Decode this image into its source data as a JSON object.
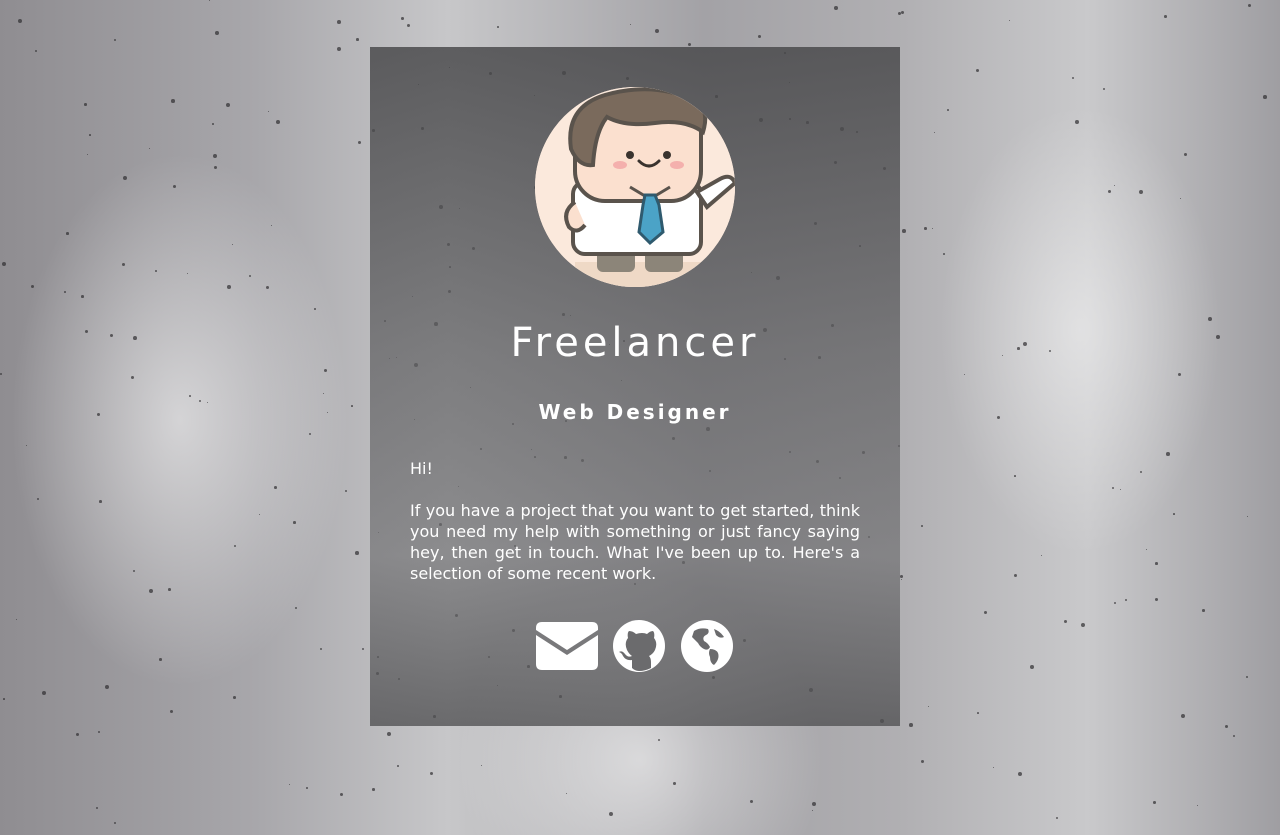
{
  "profile": {
    "name": "Freelancer",
    "role": "Web Designer",
    "greeting": "Hi!",
    "bio": "If you have a project that you want to get started, think you need my help with something or just fancy saying hey, then get in touch. What I've been up to. Here's a selection of some recent work.",
    "avatar_icon": "cartoon-office-man-avatar"
  },
  "social": [
    {
      "name": "email",
      "icon": "envelope-icon"
    },
    {
      "name": "github",
      "icon": "github-icon"
    },
    {
      "name": "website",
      "icon": "globe-icon"
    }
  ],
  "colors": {
    "card_bg": "#5f5f61",
    "text": "#ffffff",
    "avatar_bg": "#f9e6d8",
    "tie": "#4ba3c7"
  }
}
